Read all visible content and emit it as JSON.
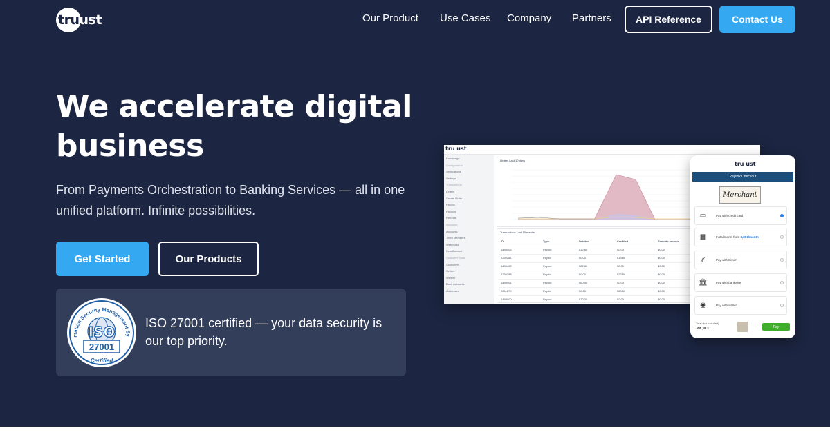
{
  "nav": {
    "logo": {
      "prefix": "tru",
      "suffix": "ust"
    },
    "links": [
      "Our Product",
      "Use Cases",
      "Company",
      "Partners"
    ],
    "api_reference": "API Reference",
    "contact": "Contact Us"
  },
  "hero": {
    "title": "We accelerate digital business",
    "subtitle": "From Payments Orchestration to Banking Services — all in one unified platform. Infinite possibilities.",
    "get_started": "Get Started",
    "our_products": "Our Products"
  },
  "iso": {
    "badge_ring": "Information Security Management System",
    "badge_iso": "ISO",
    "badge_number": "27001",
    "badge_certified": "Certified",
    "text": "ISO 27001 certified — your data security is our top priority."
  },
  "dashboard": {
    "logo": "tru ust",
    "sidebar": [
      {
        "label": "Homepage",
        "header": false
      },
      {
        "label": "Configuration",
        "header": true
      },
      {
        "label": "Verifications",
        "header": false
      },
      {
        "label": "Settings",
        "header": false
      },
      {
        "label": "Transactions",
        "header": true
      },
      {
        "label": "Orders",
        "header": false
      },
      {
        "label": "Create Order",
        "header": false
      },
      {
        "label": "Paylink",
        "header": false
      },
      {
        "label": "Payouts",
        "header": false
      },
      {
        "label": "Refunds",
        "header": false
      },
      {
        "label": "Accounts",
        "header": true
      },
      {
        "label": "Accounts",
        "header": false
      },
      {
        "label": "Team Members",
        "header": false
      },
      {
        "label": "Webhooks",
        "header": false
      },
      {
        "label": "New Account",
        "header": false
      },
      {
        "label": "Customer Data",
        "header": true
      },
      {
        "label": "Customers",
        "header": false
      },
      {
        "label": "Sellers",
        "header": false
      },
      {
        "label": "Wallets",
        "header": false
      },
      {
        "label": "Bank Accounts",
        "header": false
      },
      {
        "label": "Addresses",
        "header": false
      }
    ],
    "chart_title": "Orders Last 10 days",
    "table_title": "Transactions Last 10 results",
    "table_headers": [
      "ID",
      "Type",
      "Debited",
      "Credited",
      "Executo amount"
    ],
    "table_rows": [
      [
        "1498403",
        "Payout",
        "$12.80",
        "$0.00",
        "$0.00"
      ],
      [
        "2255281",
        "Paylin",
        "$0.00",
        "$13.80",
        "$0.00"
      ],
      [
        "1498402",
        "Payout",
        "$22.80",
        "$0.00",
        "$0.00"
      ],
      [
        "2255288",
        "Paylin",
        "$0.00",
        "$22.80",
        "$0.00"
      ],
      [
        "1498901",
        "Payout",
        "$60.50",
        "$0.00",
        "$0.00"
      ],
      [
        "2261279",
        "Paylin",
        "$0.00",
        "$60.50",
        "$0.00"
      ],
      [
        "1498900",
        "Payout",
        "$70.20",
        "$0.00",
        "$0.00"
      ]
    ]
  },
  "checkout": {
    "logo": "tru ust",
    "title": "Paylink Checkout",
    "merchant": "Merchant",
    "options": [
      {
        "label": "Pay with credit card",
        "icon": "credit-card-icon",
        "selected": true
      },
      {
        "label": "Installments from",
        "highlight": "3,80€/month",
        "icon": "installments-icon",
        "selected": false
      },
      {
        "label": "Pay with Bizum",
        "icon": "bizum-icon",
        "selected": false
      },
      {
        "label": "Pay with bankwire",
        "icon": "bank-icon",
        "selected": false
      },
      {
        "label": "Pay with wallet",
        "icon": "wallet-icon",
        "selected": false
      }
    ],
    "total_label": "Total (tax included)",
    "total_amount": "398,00 €",
    "pay_button": "Pay"
  },
  "colors": {
    "hero_bg": "#1c2541",
    "accent": "#35a8f2",
    "card_bg": "#333e5a"
  }
}
